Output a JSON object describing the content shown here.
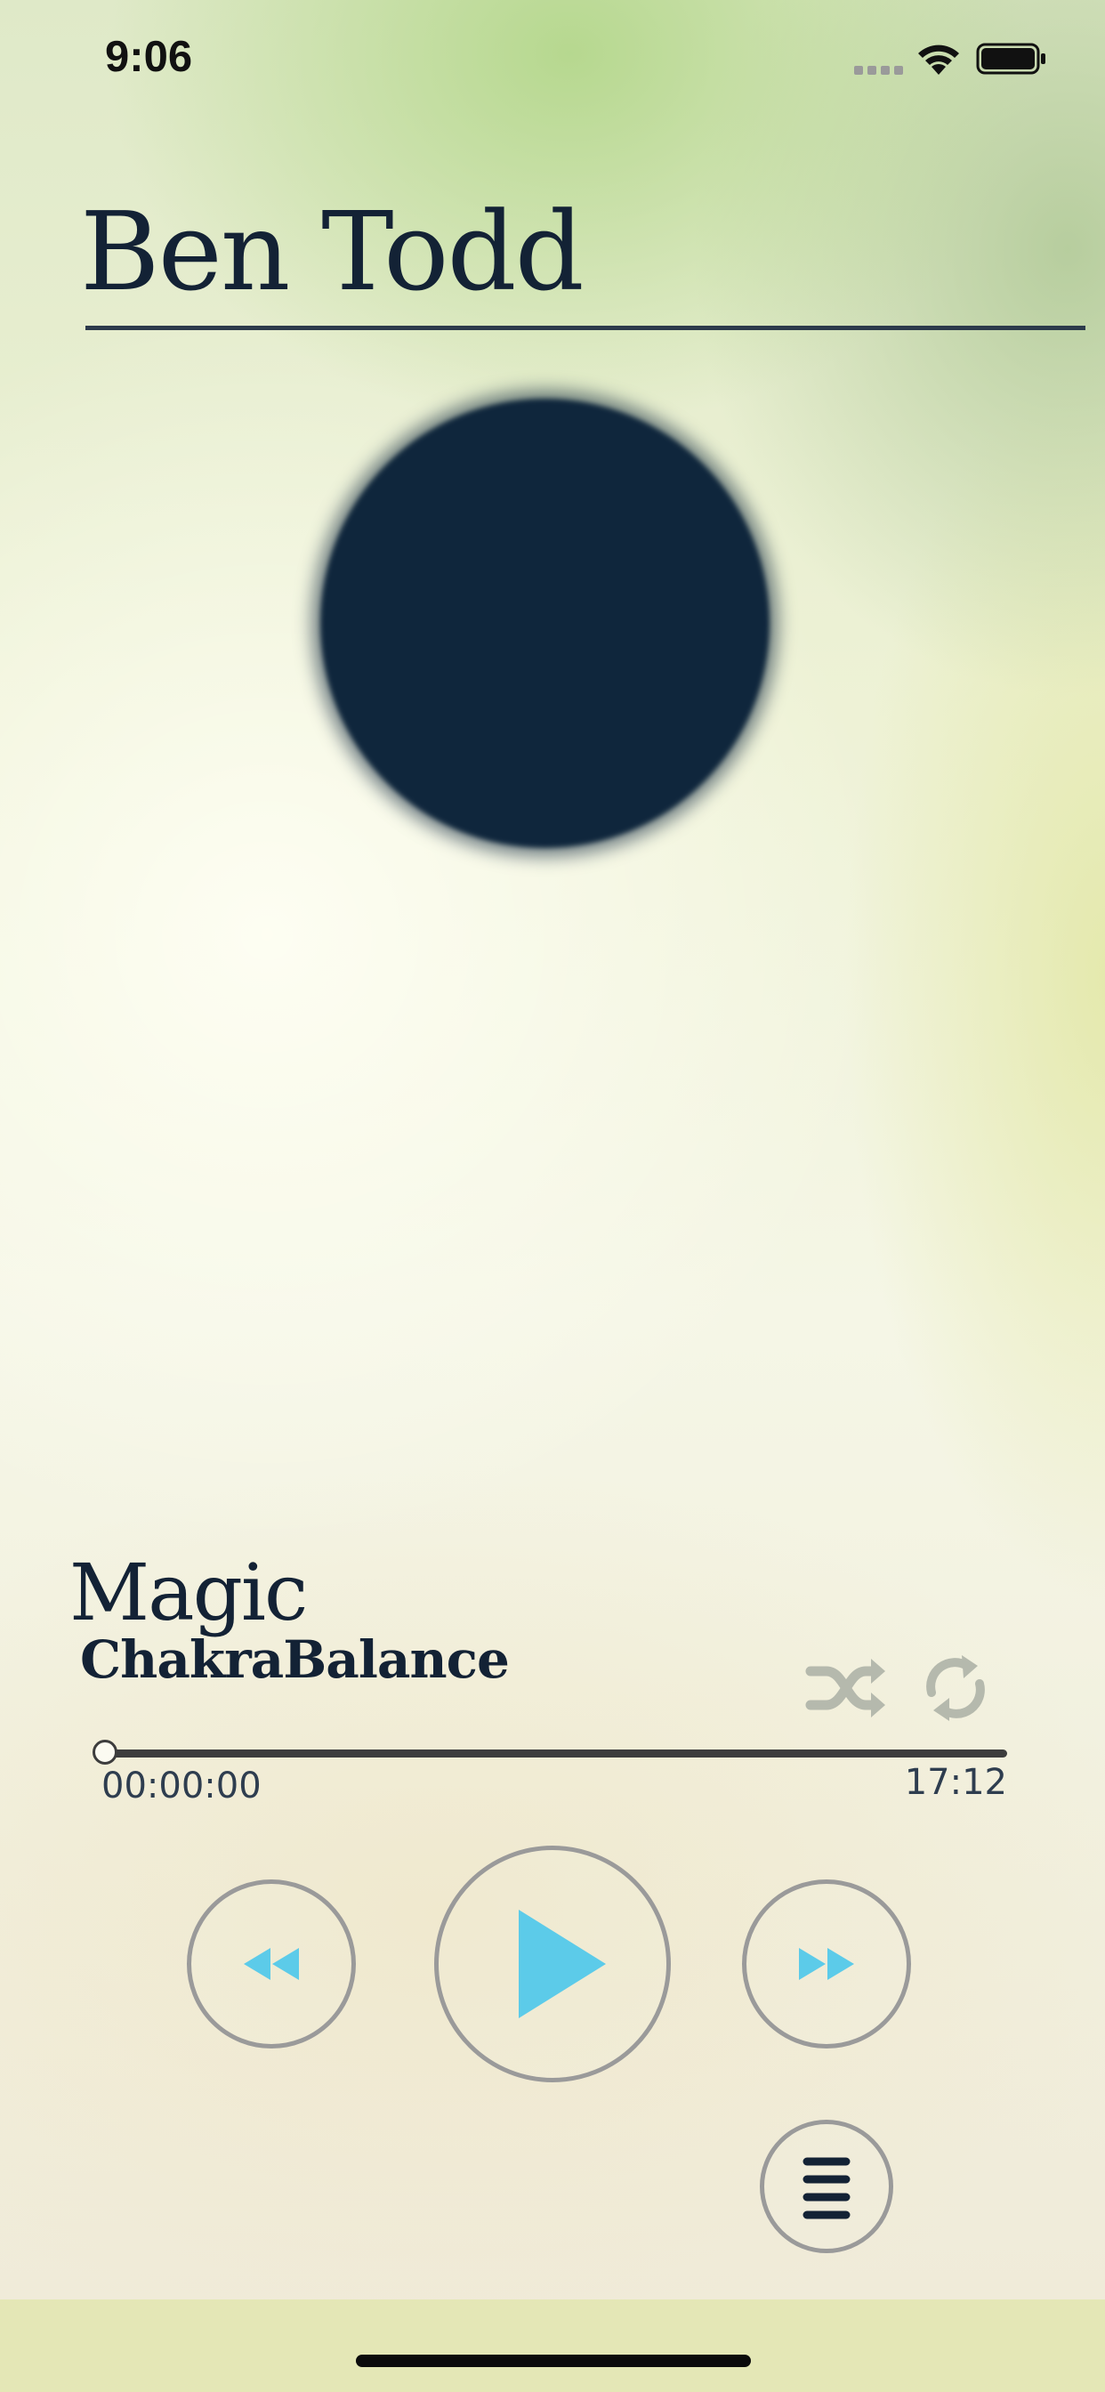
{
  "status_bar": {
    "time": "9:06",
    "icons": [
      "cellular-signal-icon",
      "wifi-icon",
      "battery-icon"
    ]
  },
  "header": {
    "artist": "Ben Todd"
  },
  "track": {
    "title": "Magic",
    "subtitle": "ChakraBalance"
  },
  "playback": {
    "elapsed": "00:00:00",
    "total": "17:12",
    "progress": 0.0,
    "shuffle_icon": "shuffle-icon",
    "repeat_icon": "repeat-icon"
  },
  "controls": {
    "rewind_icon": "rewind-icon",
    "play_icon": "play-icon",
    "forward_icon": "fast-forward-icon",
    "menu_icon": "menu-icon"
  },
  "colors": {
    "accent": "#5ccbe9",
    "text_dark": "#132235",
    "artwork": "#0f263c",
    "control_border": "#9a9a9a"
  }
}
